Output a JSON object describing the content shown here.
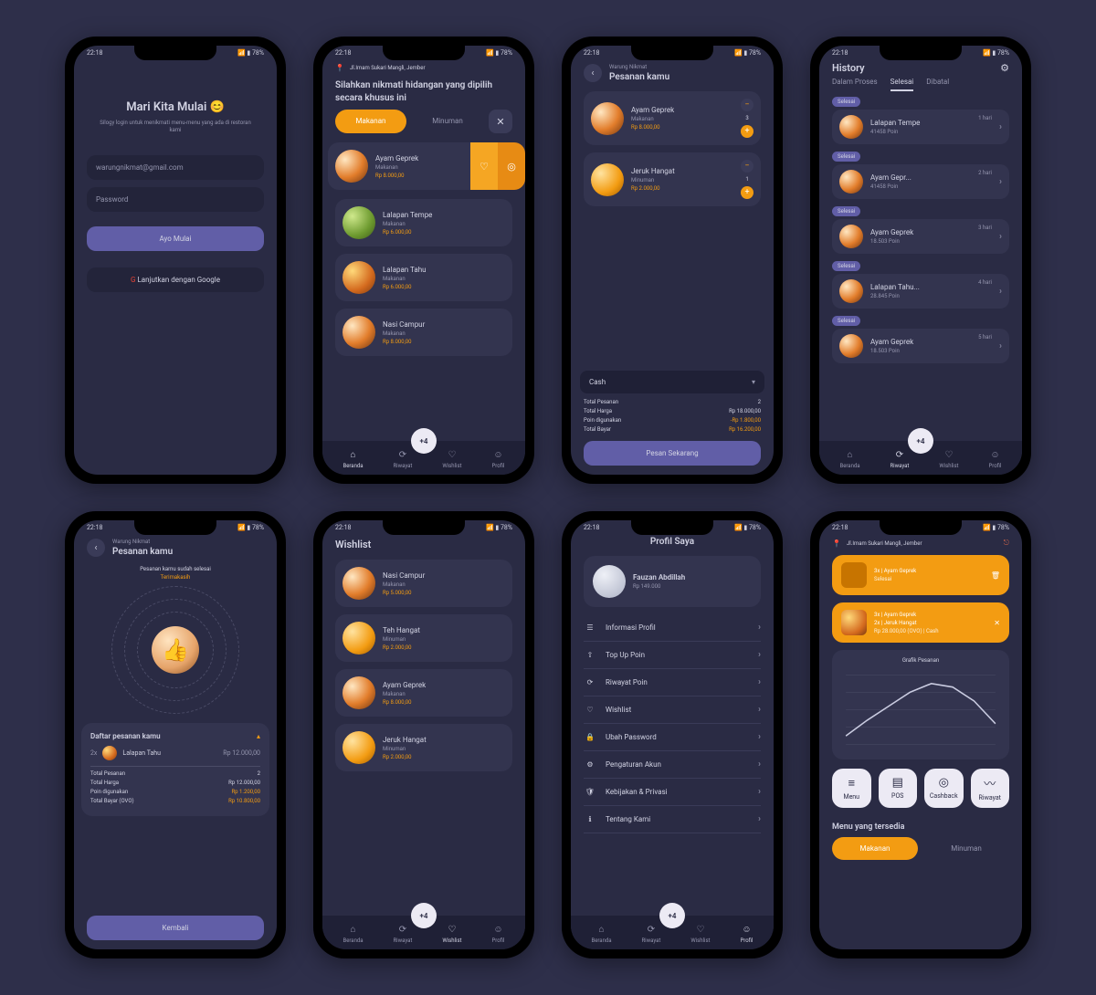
{
  "status": {
    "time": "22:18",
    "right": "📶 ▮ 78%"
  },
  "nav": {
    "items": [
      "Beranda",
      "Riwayat",
      "Wishlist",
      "Profil"
    ],
    "cart": "+4"
  },
  "login": {
    "title": "Mari Kita Mulai 😊",
    "subtitle": "Silogy login untuk menikmati menu-menu yang ada di restoran kami",
    "email": "warungnikmat@gmail.com",
    "password": "Password",
    "start": "Ayo Mulai",
    "google": "Lanjutkan dengan Google"
  },
  "menu": {
    "location": "Jl.Imam Sukari Mangli, Jember",
    "headline": "Silahkan nikmati hidangan yang dipilih secara khusus ini",
    "tabs": {
      "food": "Makanan",
      "drink": "Minuman"
    },
    "items": [
      {
        "name": "Ayam Geprek",
        "cat": "Makanan",
        "price": "Rp 8.000,00"
      },
      {
        "name": "Lalapan Tempe",
        "cat": "Makanan",
        "price": "Rp 6.000,00"
      },
      {
        "name": "Lalapan Tahu",
        "cat": "Makanan",
        "price": "Rp 6.000,00"
      },
      {
        "name": "Nasi Campur",
        "cat": "Makanan",
        "price": "Rp 8.000,00"
      }
    ]
  },
  "cart": {
    "store": "Warung Nikmat",
    "title": "Pesanan kamu",
    "items": [
      {
        "name": "Ayam Geprek",
        "cat": "Makanan",
        "price": "Rp 8.000,00",
        "qty": "3"
      },
      {
        "name": "Jeruk Hangat",
        "cat": "Minuman",
        "price": "Rp 2.000,00",
        "qty": "1"
      }
    ],
    "paylabel": "Cash",
    "rows": [
      [
        "Total Pesanan",
        "2"
      ],
      [
        "Total Harga",
        "Rp 18.000,00"
      ],
      [
        "Poin digunakan",
        "-Rp 1.800,00"
      ],
      [
        "Total Bayar",
        "Rp 16.200,00"
      ]
    ],
    "cta": "Pesan Sekarang"
  },
  "history": {
    "title": "History",
    "tabs": [
      "Dalam Proses",
      "Selesai",
      "Dibatal"
    ],
    "items": [
      {
        "status": "Selesai",
        "name": "Lalapan Tempe",
        "sub": "41458 Poin",
        "ago": "1 hari"
      },
      {
        "status": "Selesai",
        "name": "Ayam Gepr...",
        "sub": "41458 Poin",
        "ago": "2 hari"
      },
      {
        "status": "Selesai",
        "name": "Ayam Geprek",
        "sub": "18.503 Poin",
        "ago": "3 hari"
      },
      {
        "status": "Selesai",
        "name": "Lalapan Tahu...",
        "sub": "28.845 Poin",
        "ago": "4 hari"
      },
      {
        "status": "Selesai",
        "name": "Ayam Geprek",
        "sub": "18.503 Poin",
        "ago": "5 hari"
      }
    ]
  },
  "done": {
    "msg": "Pesanan kamu sudah selesai",
    "thanks": "Terimakasih",
    "listTitle": "Daftar pesanan kamu",
    "item": {
      "qty": "2x",
      "name": "Lalapan Tahu",
      "price": "Rp 12.000,00"
    },
    "rows": [
      [
        "Total Pesanan",
        "2"
      ],
      [
        "Total Harga",
        "Rp 12.000,00"
      ],
      [
        "Poin digunakan",
        "Rp 1.200,00"
      ],
      [
        "Total Bayar (OVO)",
        "Rp 10.800,00"
      ]
    ],
    "cta": "Kembali"
  },
  "wishlist": {
    "title": "Wishlist",
    "items": [
      {
        "name": "Nasi Campur",
        "cat": "Makanan",
        "price": "Rp 5.000,00"
      },
      {
        "name": "Teh Hangat",
        "cat": "Minuman",
        "price": "Rp 2.000,00"
      },
      {
        "name": "Ayam Geprek",
        "cat": "Makanan",
        "price": "Rp 8.000,00"
      },
      {
        "name": "Jeruk Hangat",
        "cat": "Minuman",
        "price": "Rp 2.000,00"
      }
    ]
  },
  "profile": {
    "title": "Profil Saya",
    "name": "Fauzan Abdillah",
    "sub": "Rp 149.000",
    "rows": [
      "Informasi Profil",
      "Top Up Poin",
      "Riwayat Poin",
      "Wishlist",
      "Ubah Password",
      "Pengaturan Akun",
      "Kebijakan & Privasi",
      "Tentang Kami"
    ]
  },
  "dash": {
    "location": "Jl.Imam Sukari Mangli, Jember",
    "alerts": [
      {
        "lines": [
          "3x | Ayam Geprek"
        ],
        "sub": "Selesai"
      },
      {
        "lines": [
          "3x | Ayam Geprek",
          "2x | Jeruk Hangat"
        ],
        "sub": "Rp 28.000,00 (OVO) | Cash"
      }
    ],
    "chartTitle": "Grafik Pesanan",
    "quick": [
      "Menu",
      "POS",
      "Cashback",
      "Riwayat"
    ],
    "availTitle": "Menu yang tersedia",
    "tabs": [
      "Makanan",
      "Minuman"
    ]
  },
  "chart_data": {
    "type": "line",
    "x": [
      1,
      2,
      3,
      4,
      5,
      6,
      7,
      8
    ],
    "values": [
      10,
      28,
      44,
      60,
      70,
      66,
      50,
      24
    ],
    "ylim": [
      0,
      80
    ],
    "title": "Grafik Pesanan"
  }
}
